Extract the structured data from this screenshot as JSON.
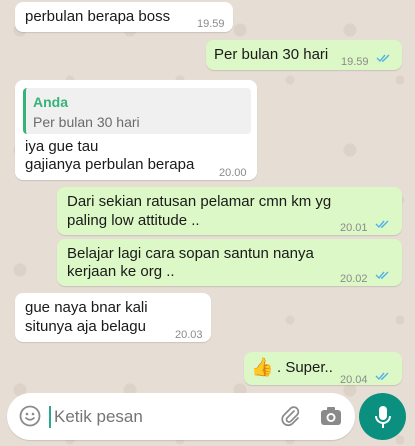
{
  "messages": [
    {
      "direction": "in",
      "text": "perbulan berapa boss",
      "time": "19.59"
    },
    {
      "direction": "out",
      "text": "Per bulan 30 hari",
      "time": "19.59",
      "status": "read"
    },
    {
      "direction": "in",
      "reply_to": {
        "author": "Anda",
        "text": "Per bulan 30 hari"
      },
      "lines": [
        "iya gue tau",
        "gajianya perbulan berapa"
      ],
      "time": "20.00"
    },
    {
      "direction": "out",
      "lines": [
        "Dari sekian ratusan pelamar cmn km yg",
        "paling low attitude .."
      ],
      "time": "20.01",
      "status": "read"
    },
    {
      "direction": "out",
      "lines": [
        "Belajar lagi cara sopan santun nanya",
        "kerjaan ke org .."
      ],
      "time": "20.02",
      "status": "read"
    },
    {
      "direction": "in",
      "lines": [
        "gue naya bnar kali",
        "situnya aja  belagu"
      ],
      "time": "20.03"
    },
    {
      "direction": "out",
      "emoji": "👍",
      "text": ". Super..",
      "time": "20.04",
      "status": "read"
    }
  ],
  "composer": {
    "placeholder": "Ketik pesan",
    "icons": {
      "emoji": "emoji-smile-icon",
      "attach": "paperclip-icon",
      "camera": "camera-icon",
      "mic": "microphone-icon"
    }
  },
  "colors": {
    "incoming_bubble": "#ffffff",
    "outgoing_bubble": "#dcf8c6",
    "read_ticks": "#4fb3e8",
    "quote_bar": "#35b37a",
    "mic_button": "#0b8f7f",
    "wallpaper": "#e6ddd4"
  }
}
